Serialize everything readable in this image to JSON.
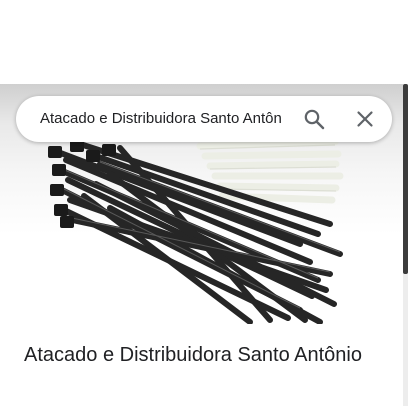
{
  "search": {
    "query": "Atacado e Distribuidora Santo Antôn"
  },
  "place": {
    "title": "Atacado e Distribuidora Santo Antônio"
  },
  "icons": {
    "search": "search-icon",
    "close": "close-icon"
  },
  "colors": {
    "text": "#202124",
    "icon": "#5f6368",
    "background": "#ffffff"
  }
}
